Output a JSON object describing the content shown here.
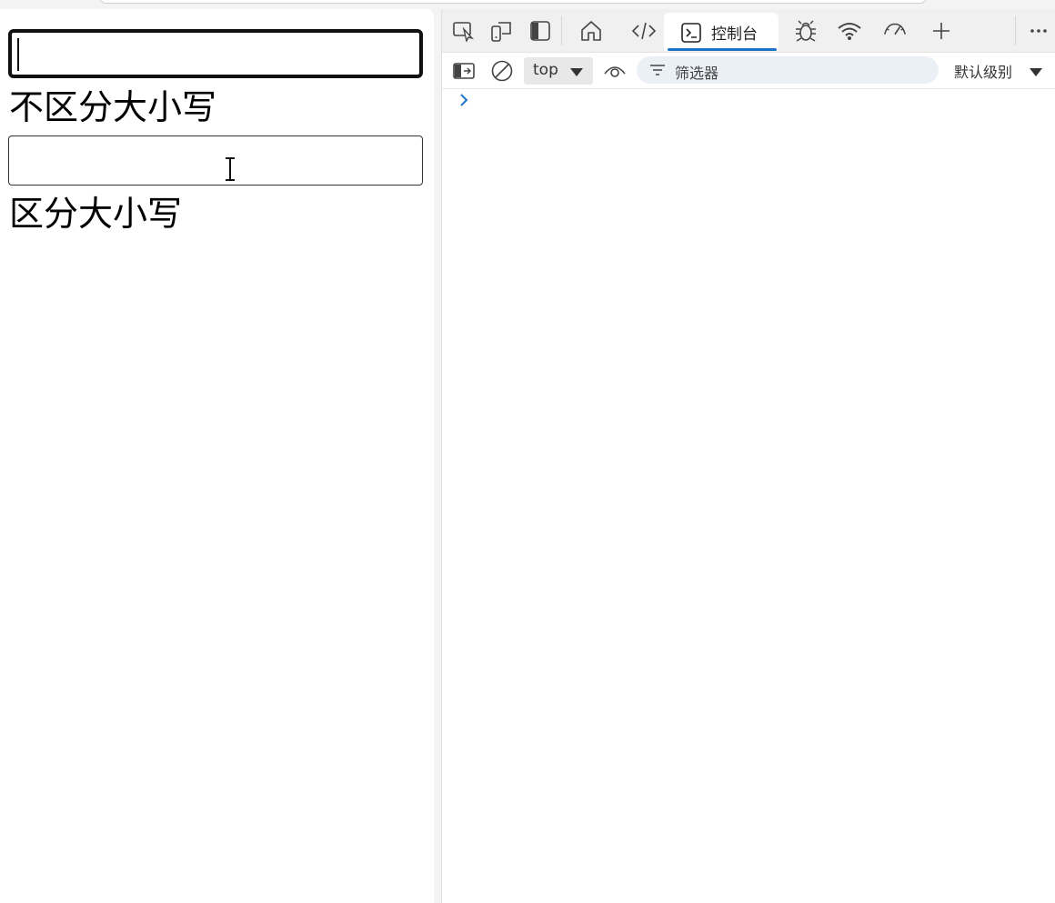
{
  "page": {
    "input_case_insensitive": {
      "value": ""
    },
    "label_case_insensitive": "不区分大小写",
    "input_case_sensitive": {
      "value": ""
    },
    "label_case_sensitive": "区分大小写"
  },
  "devtools": {
    "tabs": [
      {
        "name": "inspect-icon"
      },
      {
        "name": "device-emulation-icon"
      },
      {
        "name": "dock-side-icon"
      },
      {
        "name": "welcome-home-icon"
      },
      {
        "name": "elements-code-icon"
      },
      {
        "name": "console",
        "label": "控制台",
        "active": true
      },
      {
        "name": "sources-bug-icon"
      },
      {
        "name": "network-wifi-icon"
      },
      {
        "name": "performance-gauge-icon"
      },
      {
        "name": "add-tab-icon"
      },
      {
        "name": "more-menu-icon"
      }
    ],
    "toolbar": {
      "context": "top",
      "filter_placeholder": "筛选器",
      "log_level": "默认级别"
    },
    "accent_color": "#1a73c6"
  }
}
